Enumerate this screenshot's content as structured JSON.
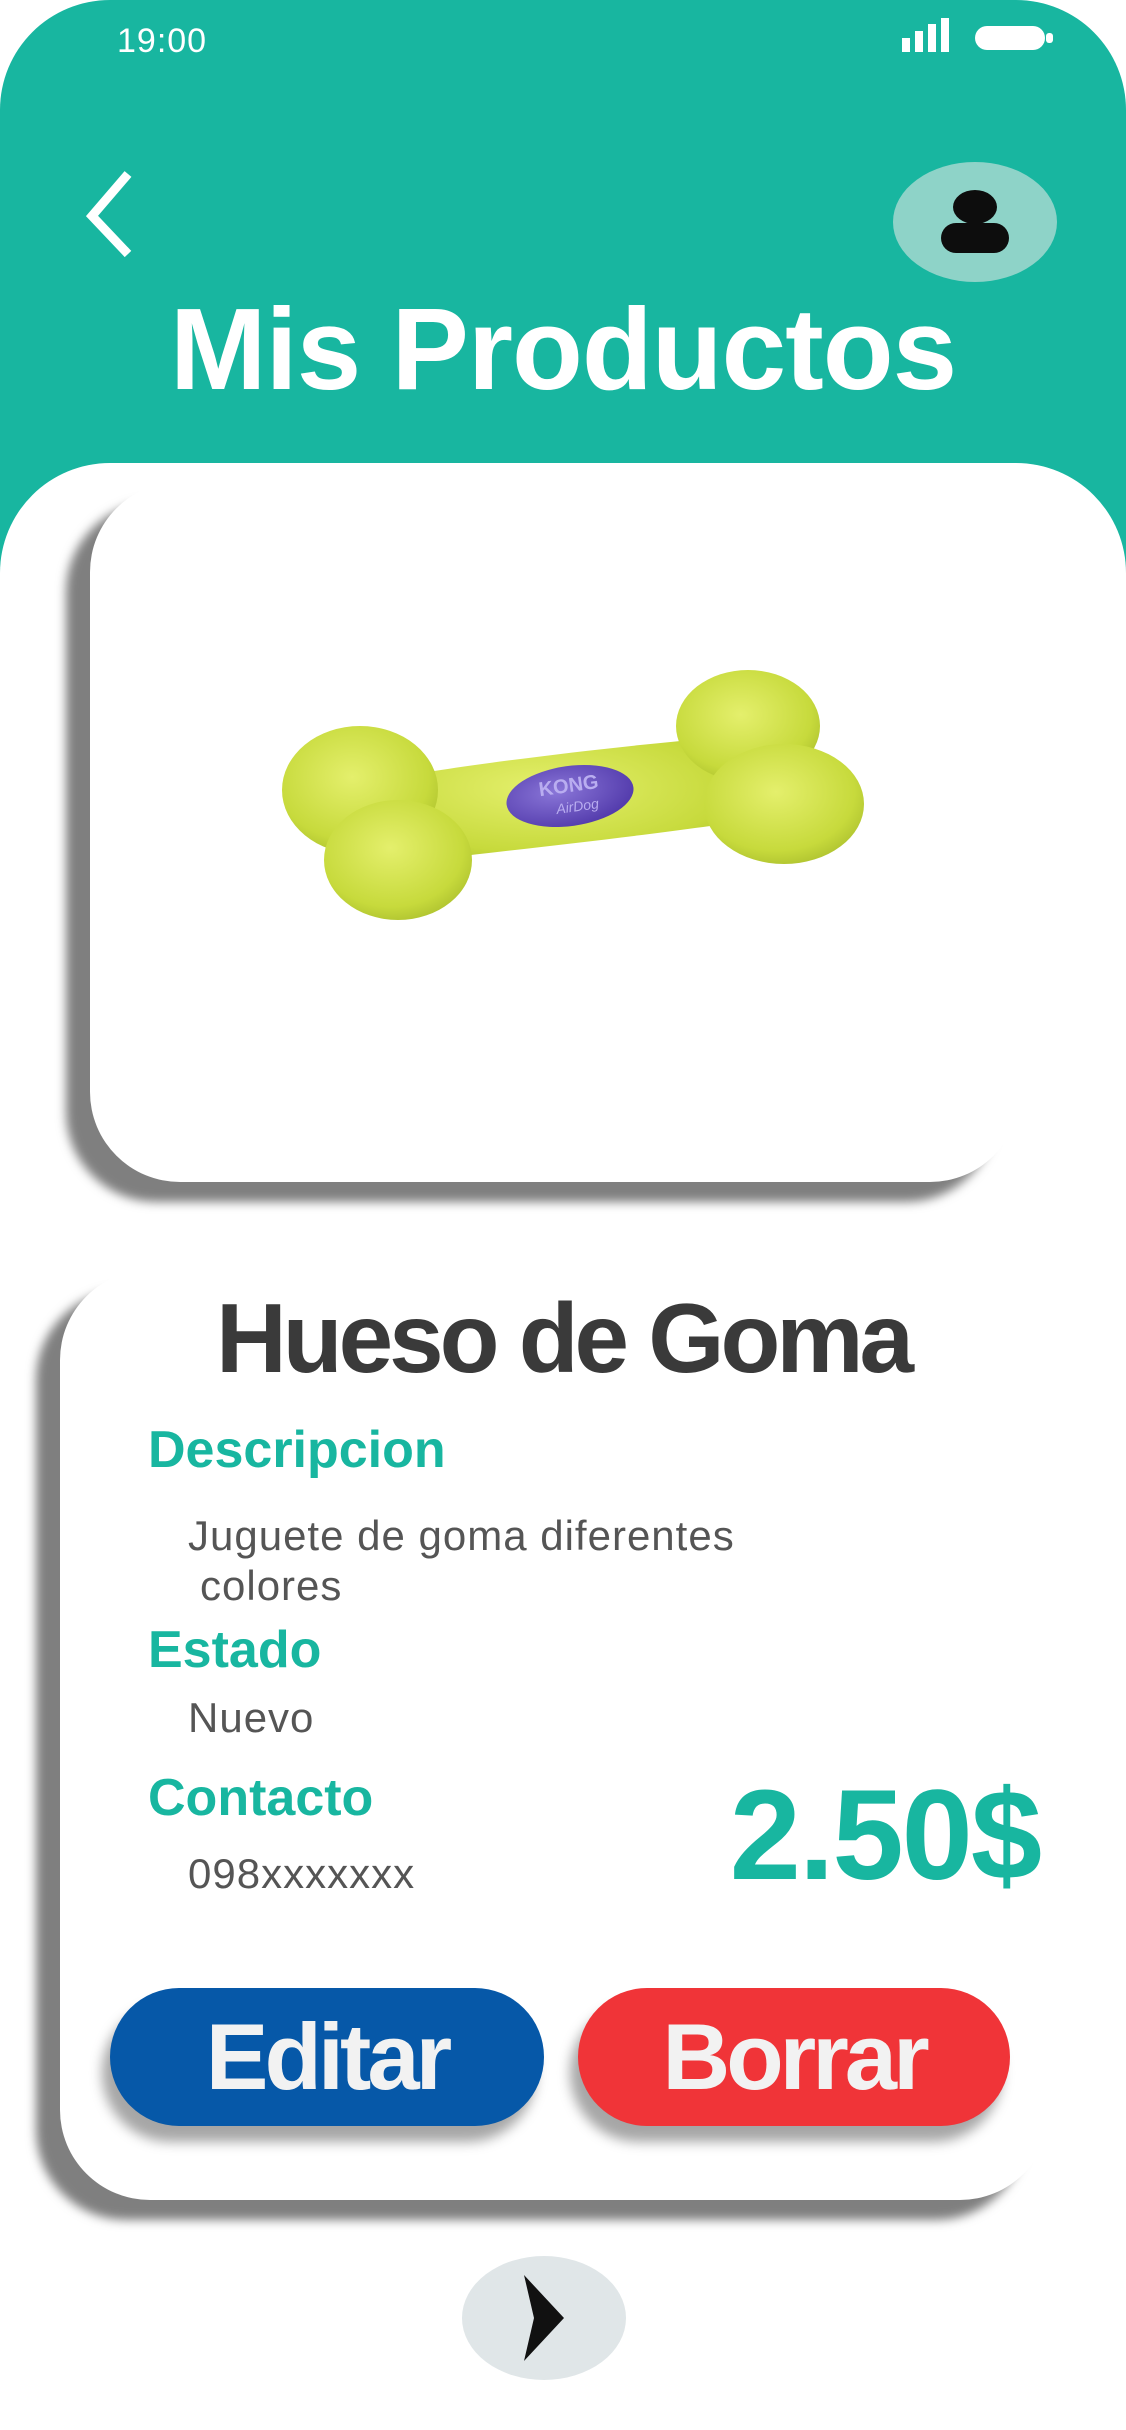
{
  "status_bar": {
    "time": "19:00",
    "signal_icon": "signal-bars-icon",
    "battery_icon": "battery-icon"
  },
  "header": {
    "title": "Mis Productos",
    "back_icon": "chevron-left-icon",
    "profile_icon": "user-icon",
    "background_color": "#18b6a0"
  },
  "product": {
    "name": "Hueso de Goma",
    "image_description": "bone-toy-image",
    "description_label": "Descripcion",
    "description_line1": "Juguete de goma diferentes",
    "description_line2": "colores",
    "status_label": "Estado",
    "status_value": "Nuevo",
    "contact_label": "Contacto",
    "contact_value": "098xxxxxxx",
    "price": "2.50$"
  },
  "actions": {
    "edit_label": "Editar",
    "delete_label": "Borrar",
    "edit_color": "#0658a8",
    "delete_color": "#f03438"
  },
  "navigation": {
    "next_icon": "chevron-right-icon"
  }
}
